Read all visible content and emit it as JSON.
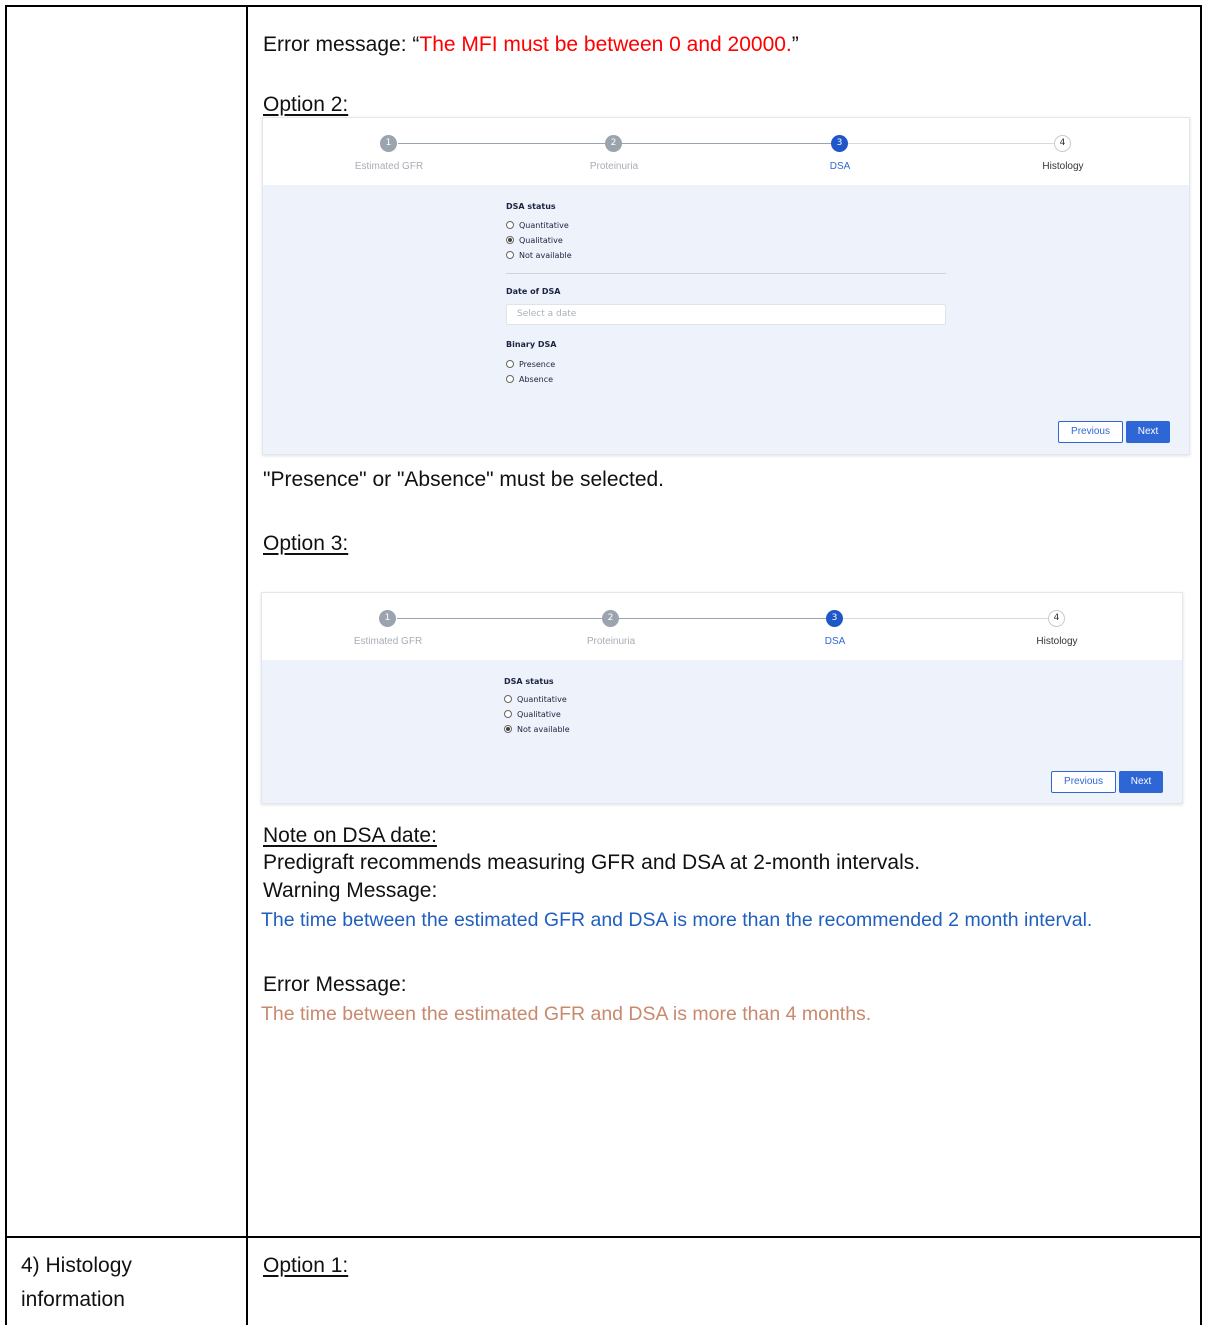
{
  "table": {
    "row1": {
      "error_prefix": "Error message: “",
      "error_text": "The MFI must be between 0 and 20000.",
      "error_suffix": "”",
      "option2_heading": "Option 2:",
      "option2_note": "\"Presence\" or \"Absence\" must be selected.",
      "option3_heading": "Option 3:",
      "note_heading": "Note on DSA date:",
      "note_text": "Predigraft recommends measuring GFR and DSA at 2-month intervals.",
      "warning_label": "Warning Message:",
      "warning_text": "The time between the estimated GFR and DSA is more than the recommended 2 month interval.",
      "error_label": "Error Message:",
      "error_message": "The time between the estimated GFR and DSA is more than 4 months."
    },
    "row2": {
      "left_line1": "4) Histology",
      "left_line2": "information",
      "option1_heading": "Option 1:"
    }
  },
  "stepper": {
    "steps": [
      {
        "number": "1",
        "label": "Estimated GFR",
        "state": "done"
      },
      {
        "number": "2",
        "label": "Proteinuria",
        "state": "done"
      },
      {
        "number": "3",
        "label": "DSA",
        "state": "active"
      },
      {
        "number": "4",
        "label": "Histology",
        "state": "todo"
      }
    ]
  },
  "form2": {
    "dsa_status_label": "DSA status",
    "status_options": [
      "Quantitative",
      "Qualitative",
      "Not available"
    ],
    "selected_status": "Qualitative",
    "date_label": "Date of DSA",
    "date_placeholder": "Select a date",
    "binary_label": "Binary DSA",
    "binary_options": [
      "Presence",
      "Absence"
    ]
  },
  "form3": {
    "dsa_status_label": "DSA status",
    "status_options": [
      "Quantitative",
      "Qualitative",
      "Not available"
    ],
    "selected_status": "Not available"
  },
  "buttons": {
    "previous": "Previous",
    "next": "Next"
  },
  "colors": {
    "error_red": "#ff0000",
    "warning_blue": "#1f5fbf",
    "error_salmon": "#c8896d",
    "active_step": "#1f56c8"
  }
}
